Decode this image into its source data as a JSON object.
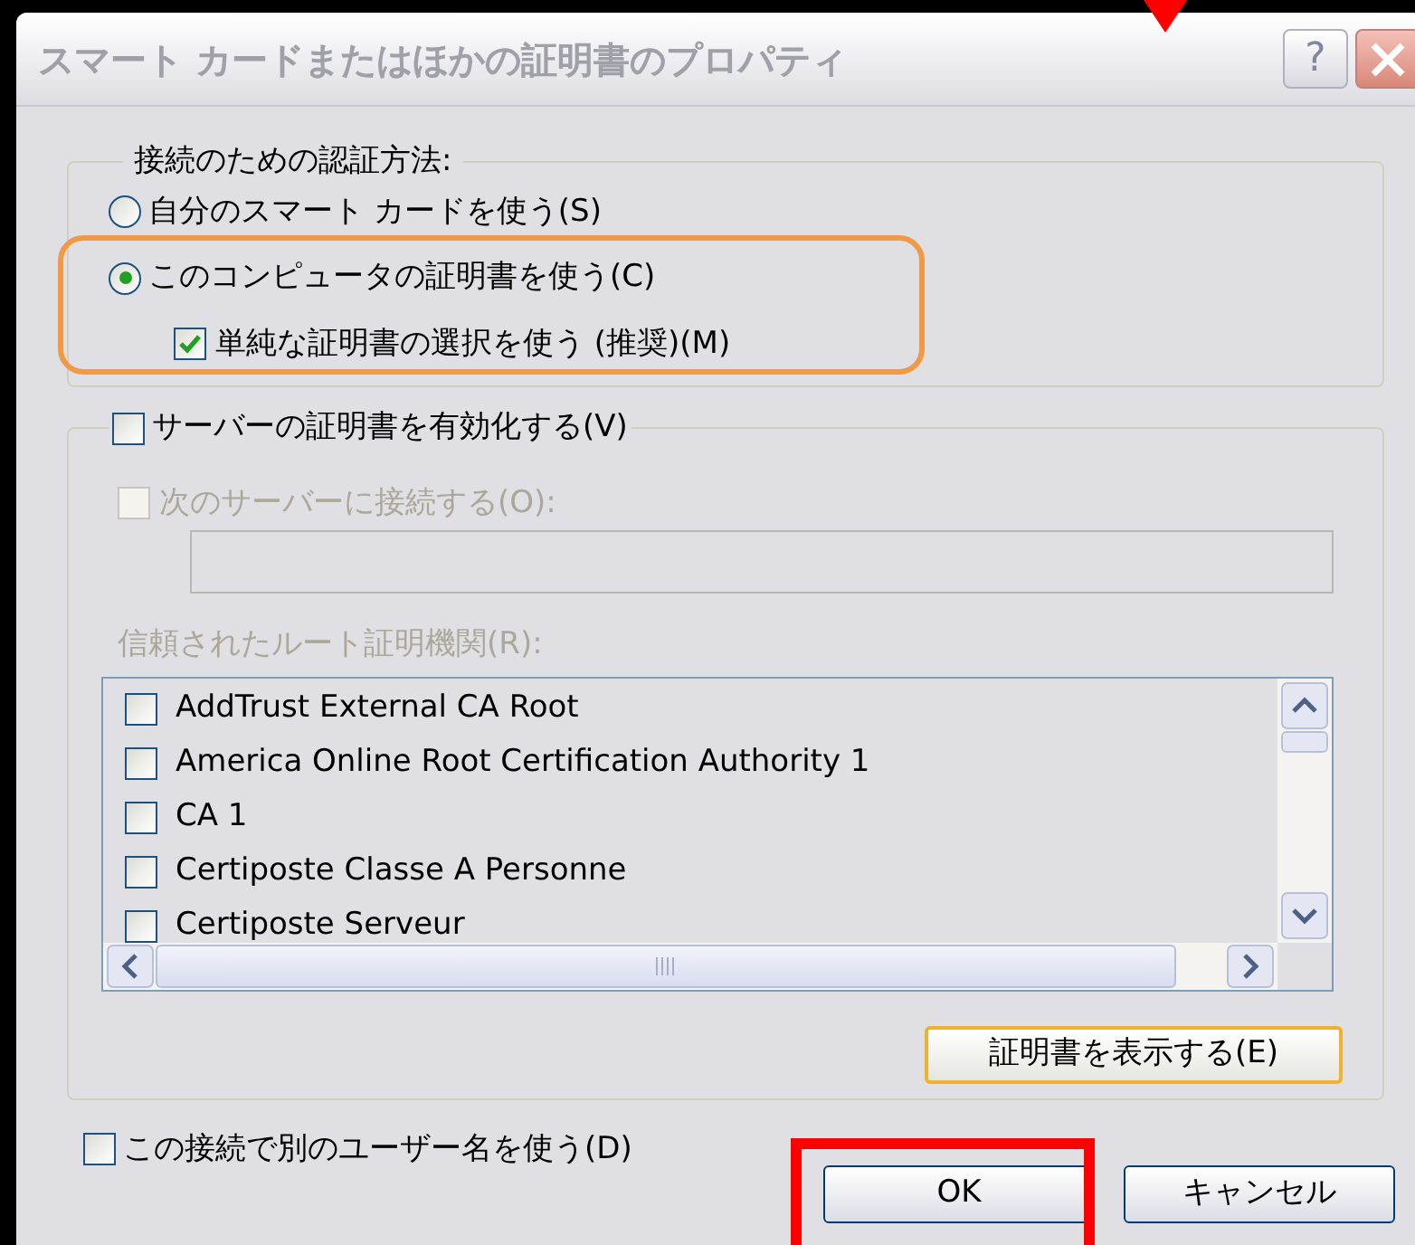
{
  "window": {
    "title": "スマート カードまたはほかの証明書のプロパティ",
    "help_button": "?"
  },
  "auth_group": {
    "legend": "接続のための認証方法:",
    "radios": [
      {
        "label": "自分のスマート カードを使う(S)",
        "selected": false
      },
      {
        "label": "このコンピュータの証明書を使う(C)",
        "selected": true
      }
    ],
    "simple_selection": {
      "label": "単純な証明書の選択を使う (推奨)(M)",
      "checked": true
    }
  },
  "server_group": {
    "validate": {
      "label": "サーバーの証明書を有効化する(V)",
      "checked": false
    },
    "connect": {
      "label": "次のサーバーに接続する(O):",
      "checked": false,
      "disabled": true
    },
    "trusted_label": {
      "text": "信頼されたルート証明機関(R):",
      "disabled": true
    },
    "trusted_list": [
      {
        "label": "AddTrust External CA Root",
        "checked": false
      },
      {
        "label": "America Online Root Certification Authority 1",
        "checked": false
      },
      {
        "label": "CA 1",
        "checked": false
      },
      {
        "label": "Certiposte Classe A Personne",
        "checked": false
      },
      {
        "label": "Certiposte Serveur",
        "checked": false
      }
    ],
    "view_button": "証明書を表示する(E)"
  },
  "alt_user": {
    "label": "この接続で別のユーザー名を使う(D)",
    "checked": false
  },
  "buttons": [
    "OK",
    "キャンセル"
  ]
}
